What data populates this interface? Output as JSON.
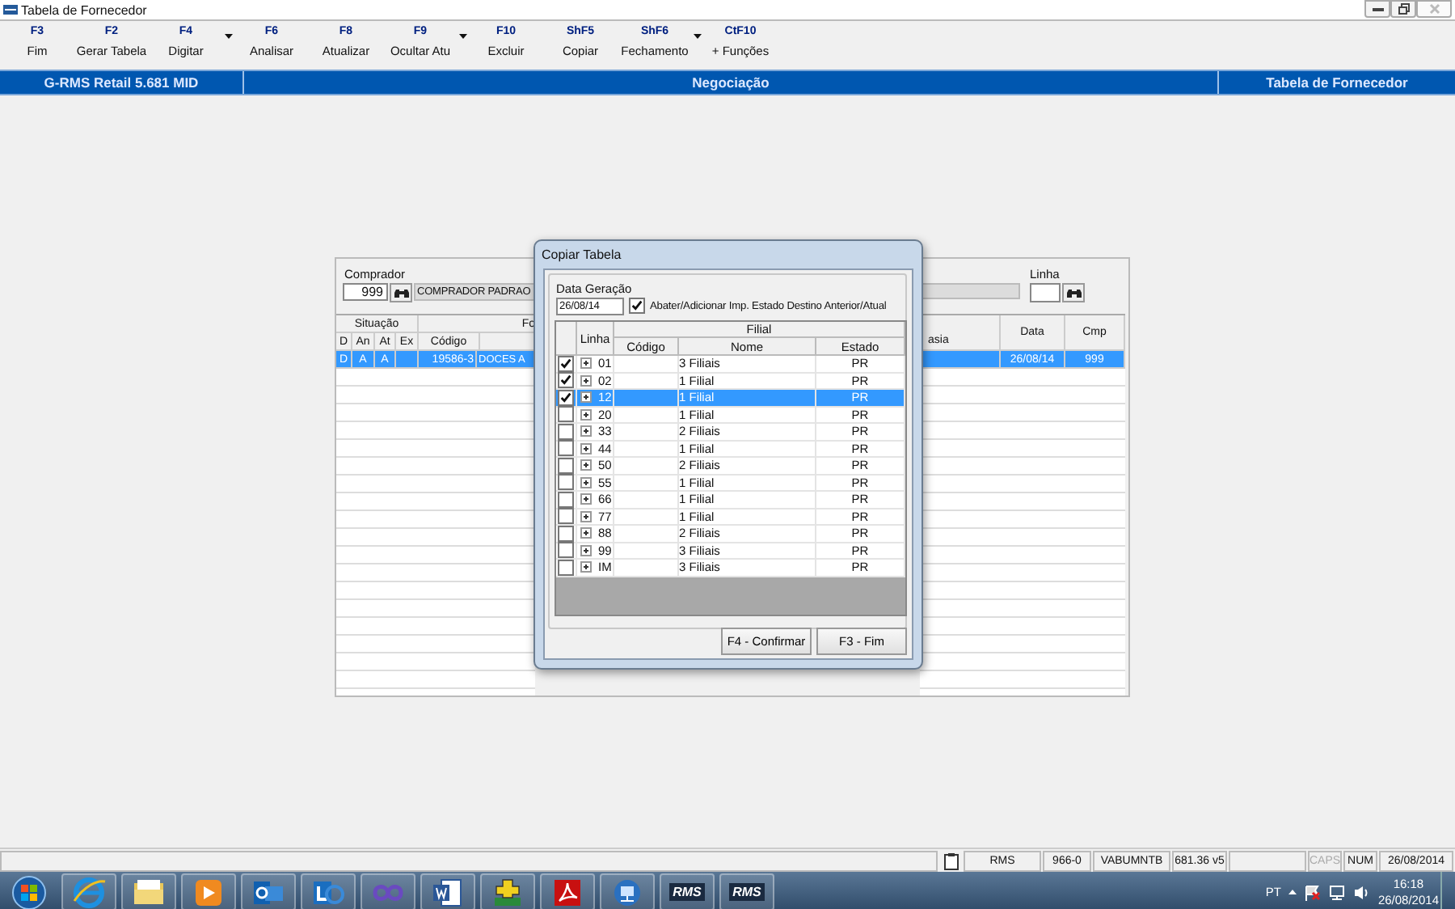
{
  "window": {
    "title": "Tabela de Fornecedor"
  },
  "toolbar": [
    {
      "key": "F3",
      "label": "Fim",
      "dropdown": false
    },
    {
      "key": "F2",
      "label": "Gerar Tabela",
      "dropdown": false
    },
    {
      "key": "F4",
      "label": "Digitar",
      "dropdown": true
    },
    {
      "key": "F6",
      "label": "Analisar",
      "dropdown": false
    },
    {
      "key": "F8",
      "label": "Atualizar",
      "dropdown": false
    },
    {
      "key": "F9",
      "label": "Ocultar Atu",
      "dropdown": true
    },
    {
      "key": "F10",
      "label": "Excluir",
      "dropdown": false
    },
    {
      "key": "ShF5",
      "label": "Copiar",
      "dropdown": false
    },
    {
      "key": "ShF6",
      "label": "Fechamento",
      "dropdown": true
    },
    {
      "key": "CtF10",
      "label": "+ Funções",
      "dropdown": false
    }
  ],
  "header_bar": {
    "left": "G-RMS Retail 5.681 MID",
    "center": "Negociação",
    "right": "Tabela de Fornecedor"
  },
  "form": {
    "comprador": {
      "label": "Comprador",
      "code": "999",
      "name": "COMPRADOR PADRAO"
    },
    "linha": {
      "label": "Linha"
    },
    "grid": {
      "group_header": "Situação",
      "columns": {
        "d": "D",
        "an": "An",
        "at": "At",
        "ex": "Ex",
        "codigo": "Código",
        "fornecedor": "Fo",
        "cut": "asia",
        "data": "Data",
        "cmp": "Cmp"
      },
      "rows": [
        {
          "selected": true,
          "d": "D",
          "an": "A",
          "at": "A",
          "codigo": "19586-3",
          "fornecedor": "DOCES A",
          "data": "26/08/14",
          "cmp": "999"
        }
      ]
    }
  },
  "dialog": {
    "title": "Copiar Tabela",
    "date_label": "Data Geração",
    "date": "26/08/14",
    "option": {
      "label": "Abater/Adicionar Imp. Estado Destino Anterior/Atual",
      "checked": true
    },
    "columns": {
      "linha": "Linha",
      "group": "Filial",
      "codigo": "Código",
      "nome": "Nome",
      "estado": "Estado"
    },
    "rows": [
      {
        "checked": true,
        "selected": false,
        "linha": "01",
        "nome": "3 Filiais",
        "estado": "PR"
      },
      {
        "checked": true,
        "selected": false,
        "linha": "02",
        "nome": "1 Filial",
        "estado": "PR"
      },
      {
        "checked": true,
        "selected": true,
        "linha": "12",
        "nome": "1 Filial",
        "estado": "PR"
      },
      {
        "checked": false,
        "selected": false,
        "linha": "20",
        "nome": "1 Filial",
        "estado": "PR"
      },
      {
        "checked": false,
        "selected": false,
        "linha": "33",
        "nome": "2 Filiais",
        "estado": "PR"
      },
      {
        "checked": false,
        "selected": false,
        "linha": "44",
        "nome": "1 Filial",
        "estado": "PR"
      },
      {
        "checked": false,
        "selected": false,
        "linha": "50",
        "nome": "2 Filiais",
        "estado": "PR"
      },
      {
        "checked": false,
        "selected": false,
        "linha": "55",
        "nome": "1 Filial",
        "estado": "PR"
      },
      {
        "checked": false,
        "selected": false,
        "linha": "66",
        "nome": "1 Filial",
        "estado": "PR"
      },
      {
        "checked": false,
        "selected": false,
        "linha": "77",
        "nome": "1 Filial",
        "estado": "PR"
      },
      {
        "checked": false,
        "selected": false,
        "linha": "88",
        "nome": "2 Filiais",
        "estado": "PR"
      },
      {
        "checked": false,
        "selected": false,
        "linha": "99",
        "nome": "3 Filiais",
        "estado": "PR"
      },
      {
        "checked": false,
        "selected": false,
        "linha": "IM",
        "nome": "3 Filiais",
        "estado": "PR"
      }
    ],
    "buttons": [
      "F4 - Confirmar",
      "F3 - Fim"
    ]
  },
  "status_bar": {
    "cells": [
      {
        "text": "RMS"
      },
      {
        "text": "966-0"
      },
      {
        "text": "VABUMNTB"
      },
      {
        "text": "681.36 v5"
      }
    ],
    "indicators": [
      {
        "text": "CAPS",
        "on": false
      },
      {
        "text": "NUM",
        "on": true
      }
    ],
    "date": "26/08/2014"
  },
  "taskbar": {
    "apps": [
      {
        "kind": "browser"
      },
      {
        "kind": "folder"
      },
      {
        "kind": "media"
      },
      {
        "kind": "mail"
      },
      {
        "kind": "chat"
      },
      {
        "kind": "infinity"
      },
      {
        "kind": "document"
      },
      {
        "kind": "plus"
      },
      {
        "kind": "pdf"
      },
      {
        "kind": "network"
      },
      {
        "kind": "rms",
        "label": "RMS"
      },
      {
        "kind": "rms",
        "label": "RMS"
      }
    ],
    "language": "PT",
    "time": "16:18",
    "date": "26/08/2014"
  }
}
